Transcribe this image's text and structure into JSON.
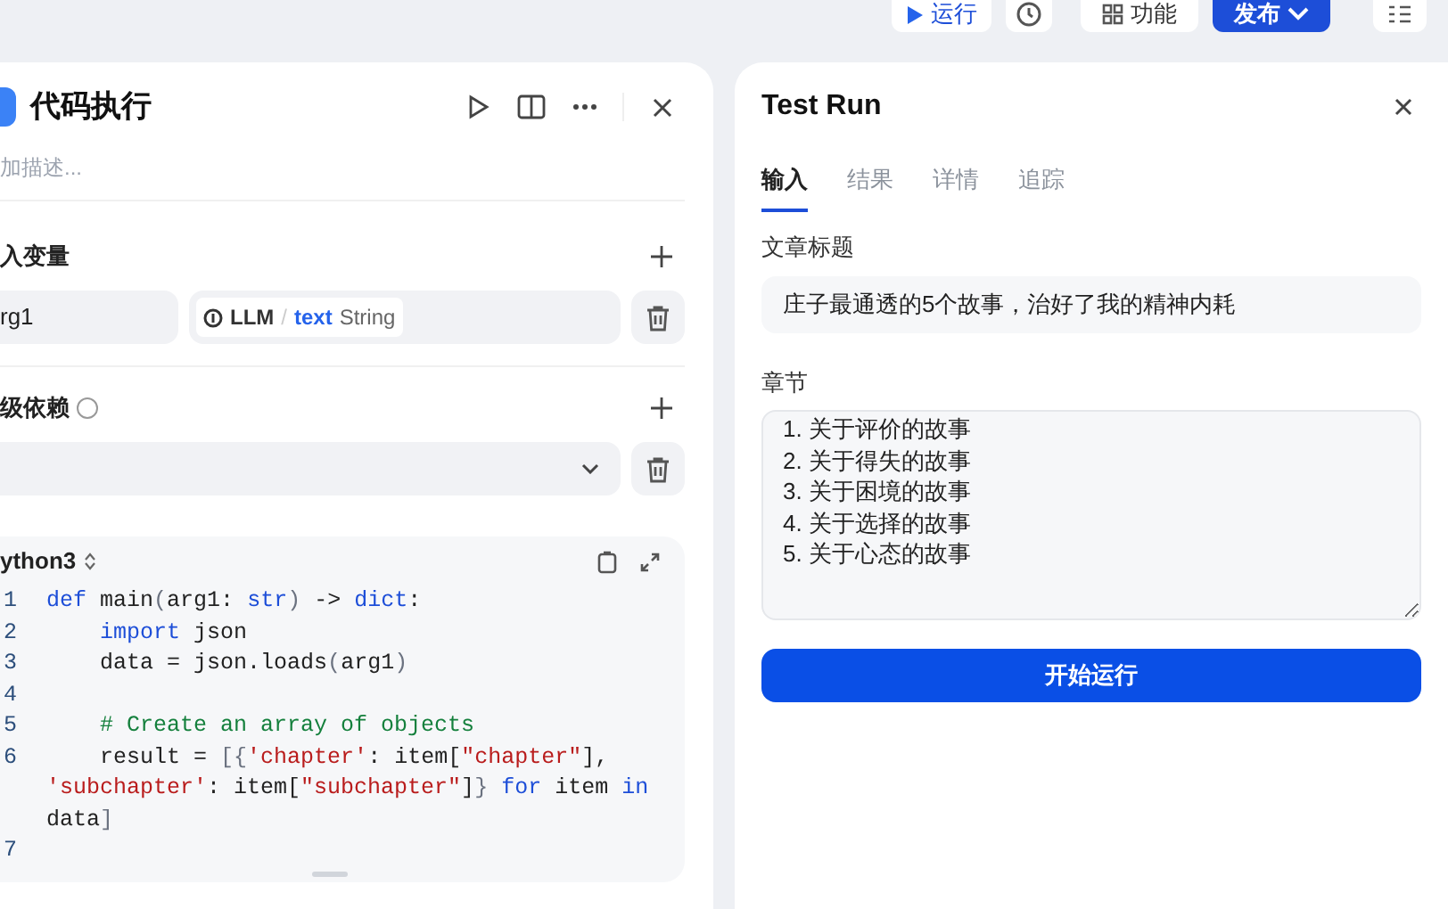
{
  "toolbar": {
    "run_label": "运行",
    "features_label": "功能",
    "publish_label": "发布"
  },
  "node_panel": {
    "title": "代码执行",
    "description_placeholder": "加描述...",
    "inputs": {
      "title": "入变量",
      "variables": [
        {
          "name": "rg1",
          "source": "LLM",
          "separator": "/",
          "field": "text",
          "type": "String"
        }
      ]
    },
    "dependencies": {
      "title": "级依赖"
    },
    "code": {
      "language": "ython3",
      "lines": [
        {
          "number": "1",
          "tokens": [
            {
              "kind": "keyword",
              "text": "def "
            },
            {
              "kind": "plain",
              "text": "main"
            },
            {
              "kind": "punct",
              "text": "("
            },
            {
              "kind": "plain",
              "text": "arg1: "
            },
            {
              "kind": "keyword",
              "text": "str"
            },
            {
              "kind": "punct",
              "text": ")"
            },
            {
              "kind": "plain",
              "text": " -> "
            },
            {
              "kind": "keyword",
              "text": "dict"
            },
            {
              "kind": "plain",
              "text": ":"
            }
          ]
        },
        {
          "number": "2",
          "tokens": [
            {
              "kind": "keyword",
              "text": "    import "
            },
            {
              "kind": "plain",
              "text": "json"
            }
          ]
        },
        {
          "number": "3",
          "tokens": [
            {
              "kind": "plain",
              "text": "    data = json.loads"
            },
            {
              "kind": "punct",
              "text": "("
            },
            {
              "kind": "plain",
              "text": "arg1"
            },
            {
              "kind": "punct",
              "text": ")"
            }
          ]
        },
        {
          "number": "4"
        },
        {
          "number": "5",
          "tokens": [
            {
              "kind": "comment",
              "text": "    # Create an array of objects"
            }
          ]
        },
        {
          "number": "6",
          "tokens": [
            {
              "kind": "plain",
              "text": "    result = "
            },
            {
              "kind": "punct",
              "text": "[{"
            },
            {
              "kind": "string",
              "text": "'chapter'"
            },
            {
              "kind": "plain",
              "text": ": item["
            },
            {
              "kind": "string",
              "text": "\"chapter\""
            },
            {
              "kind": "plain",
              "text": "], "
            },
            {
              "kind": "string",
              "text": "'subchapter'"
            },
            {
              "kind": "plain",
              "text": ": item["
            },
            {
              "kind": "string",
              "text": "\"subchapter\""
            },
            {
              "kind": "plain",
              "text": "]"
            },
            {
              "kind": "punct",
              "text": "}"
            },
            {
              "kind": "keyword",
              "text": " for "
            },
            {
              "kind": "plain",
              "text": "item "
            },
            {
              "kind": "keyword",
              "text": "in "
            },
            {
              "kind": "plain",
              "text": "data"
            },
            {
              "kind": "punct",
              "text": "]"
            }
          ]
        },
        {
          "number": "7"
        }
      ]
    }
  },
  "test_run": {
    "title": "Test Run",
    "tabs": [
      {
        "label": "输入",
        "selected": true,
        "disabled": false
      },
      {
        "label": "结果",
        "selected": false,
        "disabled": true
      },
      {
        "label": "详情",
        "selected": false,
        "disabled": true
      },
      {
        "label": "追踪",
        "selected": false,
        "disabled": true
      }
    ],
    "fields": [
      {
        "label": "文章标题",
        "kind": "input",
        "value": "庄子最通透的5个故事，治好了我的精神内耗"
      },
      {
        "label": "章节",
        "kind": "textarea",
        "value": "1. 关于评价的故事\n2. 关于得失的故事\n3. 关于困境的故事\n4. 关于选择的故事\n5. 关于心态的故事"
      }
    ],
    "start_button": "开始运行"
  }
}
